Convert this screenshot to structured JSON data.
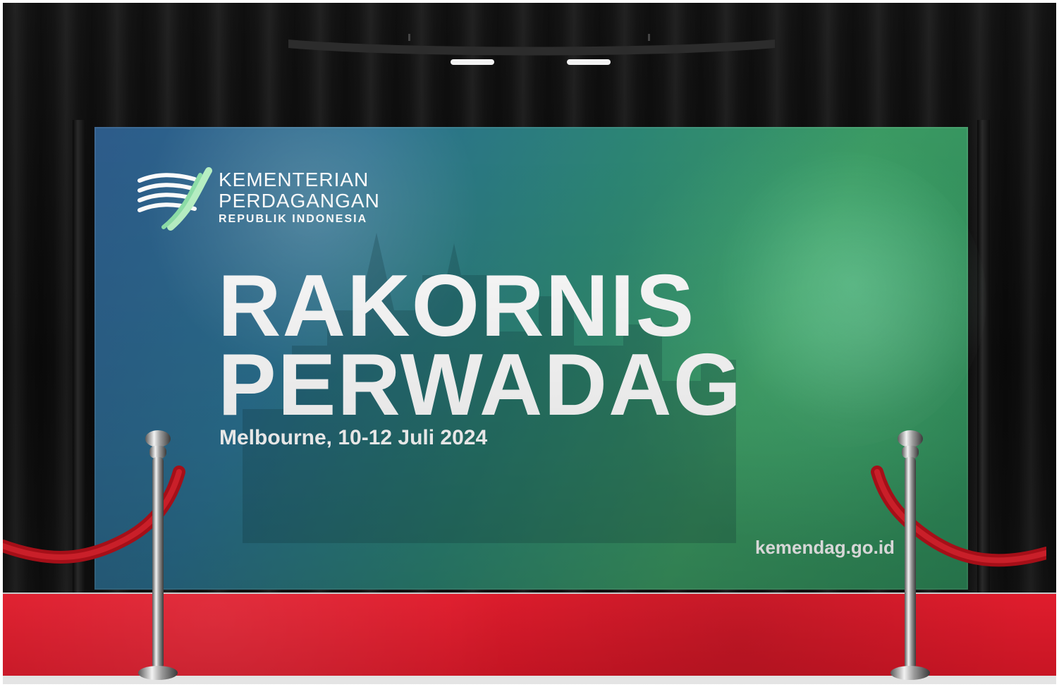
{
  "scene": {
    "banner": {
      "logo_text": {
        "line1": "KEMENTERIAN",
        "line2": "PERDAGANGAN",
        "line3": "REPUBLIK INDONESIA"
      },
      "title_line1": "RAKORNIS",
      "title_line2": "PERWADAG",
      "subtitle": "Melbourne, 10-12 Juli 2024",
      "website": "kemendag.go.id"
    }
  }
}
